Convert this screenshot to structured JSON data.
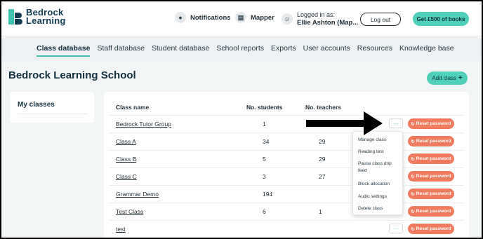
{
  "brand": {
    "line1": "Bedrock",
    "line2": "Learning"
  },
  "header": {
    "notifications": "Notifications",
    "mapper": "Mapper",
    "logged_in_label": "Logged in as:",
    "user_name": "Ellie Ashton (Map...",
    "logout": "Log out",
    "promo": "Get £500 of books"
  },
  "tabs": [
    {
      "label": "Class database",
      "active": true
    },
    {
      "label": "Staff database"
    },
    {
      "label": "Student database"
    },
    {
      "label": "School reports"
    },
    {
      "label": "Exports"
    },
    {
      "label": "User accounts"
    },
    {
      "label": "Resources"
    },
    {
      "label": "Knowledge base"
    }
  ],
  "page": {
    "school_name": "Bedrock Learning School",
    "add_class": "Add class"
  },
  "sidebar": {
    "title": "My classes"
  },
  "table": {
    "columns": {
      "name": "Class name",
      "students": "No. students",
      "teachers": "No. teachers"
    },
    "rows": [
      {
        "name": "Bedrock Tutor Group",
        "students": "1",
        "teachers": ""
      },
      {
        "name": "Class A",
        "students": "34",
        "teachers": "29"
      },
      {
        "name": "Class B",
        "students": "5",
        "teachers": "29"
      },
      {
        "name": "Class C",
        "students": "3",
        "teachers": "27"
      },
      {
        "name": "Grammar Demo",
        "students": "194",
        "teachers": ""
      },
      {
        "name": "Test Class",
        "students": "6",
        "teachers": "1"
      },
      {
        "name": "test",
        "students": "",
        "teachers": ""
      }
    ],
    "more_label": "···",
    "reset_label": "Reset password"
  },
  "menu": {
    "items": [
      "Manage class",
      "Reading test",
      "Pause class drip feed",
      "Block allocation",
      "Audio settings",
      "Delete class"
    ]
  },
  "colors": {
    "accent": "#4fd0b9",
    "reset": "#f07a5e",
    "navy": "#14303f"
  }
}
